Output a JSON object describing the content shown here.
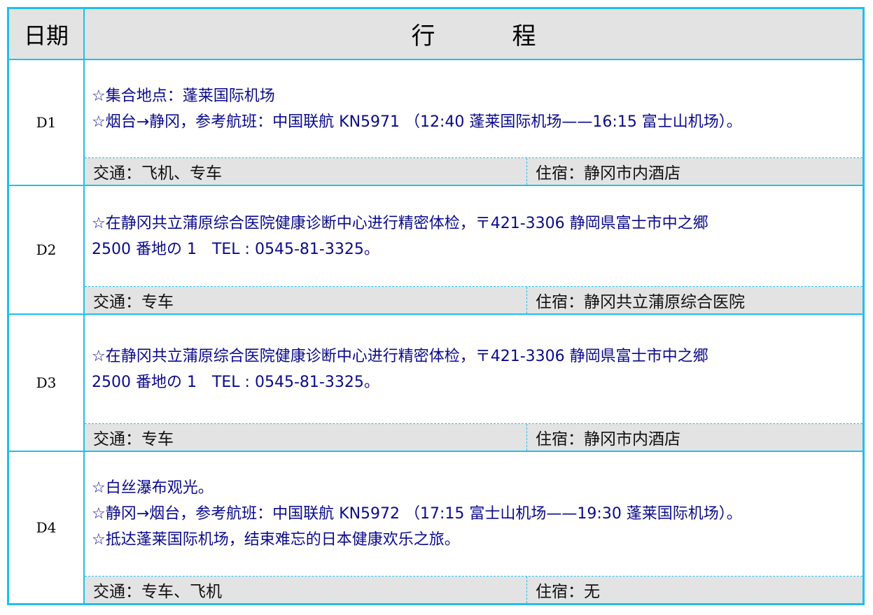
{
  "header": {
    "date_label": "日期",
    "plan_label": "行程"
  },
  "days": [
    {
      "day": "D1",
      "lines": [
        "☆集合地点：蓬莱国际机场",
        "☆烟台→静冈，参考航班：中国联航 KN5971 （12:40 蓬莱国际机场——16:15 富士山机场）。"
      ],
      "transport": "交通：飞机、专车",
      "lodging": "住宿：静冈市内酒店"
    },
    {
      "day": "D2",
      "lines": [
        "☆在静冈共立蒲原综合医院健康诊断中心进行精密体检，〒421-3306 静岡県富士市中之郷",
        "2500 番地の 1　TEL : 0545-81-3325。"
      ],
      "transport": "交通：专车",
      "lodging": "住宿：静冈共立蒲原综合医院"
    },
    {
      "day": "D3",
      "lines": [
        "☆在静冈共立蒲原综合医院健康诊断中心进行精密体检，〒421-3306 静岡県富士市中之郷",
        "2500 番地の 1　TEL : 0545-81-3325。"
      ],
      "transport": "交通：专车",
      "lodging": "住宿：静冈市内酒店"
    },
    {
      "day": "D4",
      "lines": [
        "☆白丝瀑布观光。",
        "☆静冈→烟台，参考航班：中国联航 KN5972 （17:15 富士山机场——19:30 蓬莱国际机场）。",
        "☆抵达蓬莱国际机场，结束难忘的日本健康欢乐之旅。"
      ],
      "transport": "交通：专车、飞机",
      "lodging": "住宿：无"
    }
  ]
}
